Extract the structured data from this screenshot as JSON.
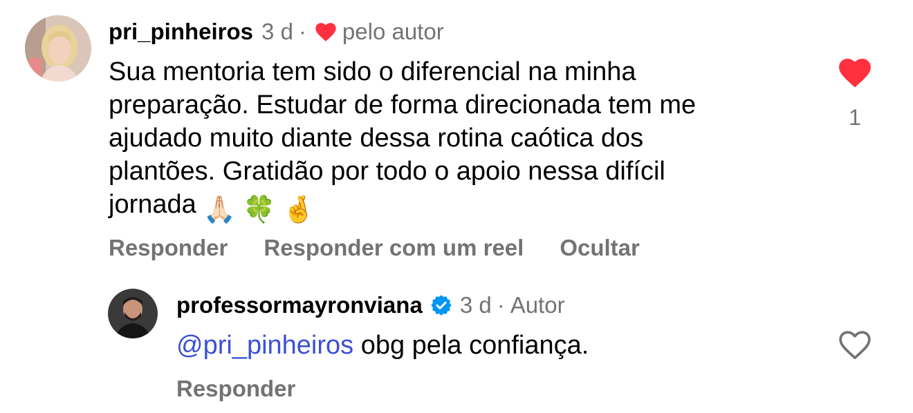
{
  "comment": {
    "username": "pri_pinheiros",
    "time": "3 d",
    "separator": "·",
    "liked_by_author_label": "pelo autor",
    "text_lines": [
      "Sua mentoria tem sido o diferencial na minha",
      "preparação. Estudar de forma direcionada tem me",
      "ajudado muito diante dessa rotina caótica dos",
      "plantões. Gratidão por todo o apoio nessa difícil",
      "jornada"
    ],
    "emojis": [
      "🙏🏻",
      "🍀",
      "🤞"
    ],
    "actions": {
      "reply": "Responder",
      "reply_with_reel": "Responder com um reel",
      "hide": "Ocultar"
    },
    "like_count": "1",
    "liked": true
  },
  "reply": {
    "username": "professormayronviana",
    "verified": true,
    "time": "3 d",
    "separator": "·",
    "author_label": "Autor",
    "mention": "@pri_pinheiros",
    "text": " obg pela confiança.",
    "actions": {
      "reply": "Responder"
    },
    "liked": false
  },
  "colors": {
    "like_red": "#ff3040",
    "verified_blue": "#0095f6",
    "mention_blue": "#3b50d6",
    "secondary_text": "#737373"
  },
  "icons": {
    "liked_heart": "filled-heart-icon",
    "unliked_heart": "outline-heart-icon",
    "verified": "verified-badge-icon"
  }
}
